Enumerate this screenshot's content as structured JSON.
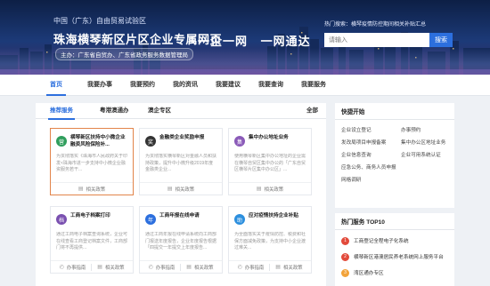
{
  "banner": {
    "subtitle": "中国（广东）自由贸易试验区",
    "title": "珠海横琴新区片区企业专属网页",
    "tag": "主办：广东省自贸办、广东省政务服务数据管理局",
    "slogan_1": "一企一网",
    "slogan_2": "一网通达",
    "hot_search": "热门搜索：横琴疫情防控期间相关补贴汇总",
    "search_placeholder": "请输入",
    "search_button": "搜索"
  },
  "nav": [
    "首页",
    "我要办事",
    "我要预约",
    "我的资讯",
    "我要建议",
    "我要查询",
    "我要服务"
  ],
  "tabs": {
    "items": [
      "推荐服务",
      "粤港澳通办",
      "澳企专区"
    ],
    "all": "全部"
  },
  "cards": [
    {
      "icon": "营",
      "color": "#2f9e5c",
      "title": "横琴新区扶持中小微企业融资风险保险补...",
      "desc": "为贯彻落实《珠海市人民政府关于印发<珠海市进一步支持中小微企业融资服务若干...",
      "foot": [
        "相关政策"
      ]
    },
    {
      "icon": "奖",
      "color": "#333333",
      "title": "金融类企业奖励申报",
      "desc": "为贯彻落实横琴新区对金融人员和扶持政策，提升中小微升级2019年度金融类企业...",
      "foot": [
        "相关政策"
      ]
    },
    {
      "icon": "集",
      "color": "#8a5ab8",
      "title": "集中办公地址业务",
      "desc": "使用横琴新区集中办公地址的企业需在横琴自贸区集中办公的「广东自贸区横琴片区集中办公区」...",
      "foot": [
        "相关政策"
      ]
    },
    {
      "icon": "档",
      "color": "#7a50b0",
      "title": "工商电子档案打印",
      "desc": "通过工商电子档案查询系统，企业可在线查看工商登记档案文件，工商部门将不再提供...",
      "foot": [
        "办事指南",
        "相关政策"
      ]
    },
    {
      "icon": "年",
      "color": "#2c6fde",
      "title": "工商年报在线申请",
      "desc": "通过工商年报在线申请系统向工商部门报送年度报告，企业年度报告根据「四提交一年提交上年度报告...",
      "foot": [
        "办事指南",
        "相关政策"
      ]
    },
    {
      "icon": "助",
      "color": "#2c8fde",
      "title": "应对疫情扶持企业补贴",
      "desc": "为全面落实关于疫情防控、税费和社保方面减免政策，为支持中小企业渡过难关...",
      "foot": [
        "办事指南",
        "相关政策"
      ]
    }
  ],
  "quick": {
    "title": "快捷开始",
    "links": [
      "企业设立登记",
      "办事预约",
      "发改局项目申报备案",
      "集中办公区地址业务",
      "企业信息查询",
      "企业可用系统认证",
      "应急公务、商务人员申报",
      "网格调研"
    ]
  },
  "hot": {
    "title": "热门服务 TOP10",
    "items": [
      {
        "rank": "1",
        "label": "工商登记全程电子化系统"
      },
      {
        "rank": "2",
        "label": "横琴新区港澳居民养老系统网上服务平台"
      },
      {
        "rank": "3",
        "label": "湾区通办专区"
      }
    ]
  },
  "colors": {
    "accent": "#2c6fde",
    "highlight": "#e2844a",
    "hot_rank": "#e24a3b"
  }
}
